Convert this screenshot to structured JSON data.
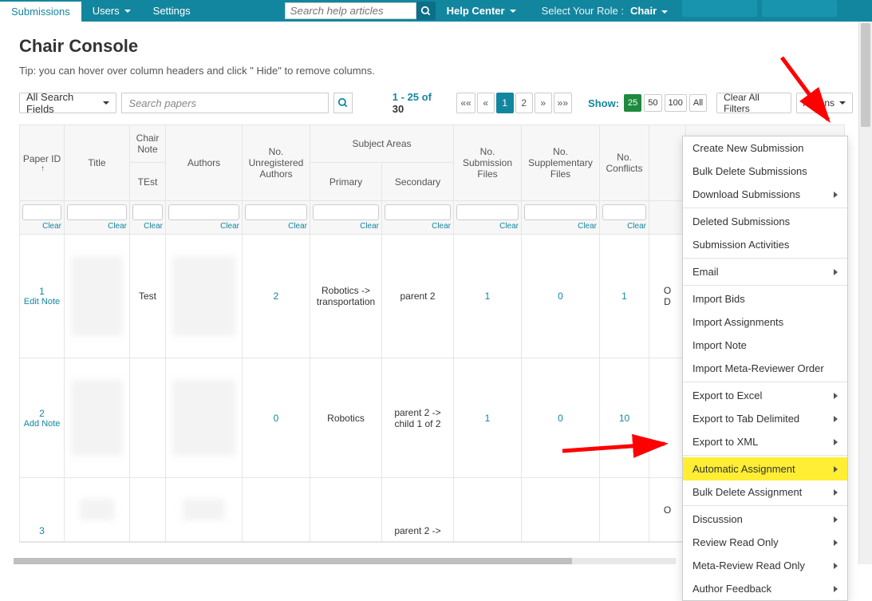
{
  "topnav": {
    "tabs": [
      "Submissions",
      "Users",
      "Settings"
    ],
    "search_placeholder": "Search help articles",
    "help_center": "Help Center",
    "role_label": "Select Your Role :",
    "role_value": "Chair"
  },
  "page": {
    "title": "Chair Console",
    "tip": "Tip: you can hover over column headers and click \" Hide\" to remove columns."
  },
  "toolbar": {
    "field_select": "All Search Fields",
    "paper_placeholder": "Search papers",
    "range": {
      "from": "1",
      "to": "25",
      "total": "30"
    },
    "pager_first": "««",
    "pager_prev": "«",
    "pager_pages": [
      "1",
      "2"
    ],
    "pager_next": "»",
    "pager_last": "»»",
    "show_label": "Show:",
    "show_options": [
      "25",
      "50",
      "100",
      "All"
    ],
    "clear_all": "Clear All Filters",
    "actions": "Actions"
  },
  "columns": {
    "paper_id": "Paper ID",
    "title": "Title",
    "chair_note": "Chair Note",
    "test": "TEst",
    "authors": "Authors",
    "unreg": "No. Unregistered Authors",
    "subject_areas": "Subject Areas",
    "primary": "Primary",
    "secondary": "Secondary",
    "nsf": "No. Submission Files",
    "nsup": "No. Supplementary Files",
    "conf": "No. Conflicts",
    "clear": "Clear"
  },
  "rows": [
    {
      "id": "1",
      "note_link": "Edit Note",
      "cnote": "Test",
      "unreg": "2",
      "primary": "Robotics -> transportation",
      "secondary": "parent 2",
      "nsf": "1",
      "nsup": "0",
      "conf": "1",
      "extra": "O\nD"
    },
    {
      "id": "2",
      "note_link": "Add Note",
      "cnote": "",
      "unreg": "0",
      "primary": "Robotics",
      "secondary": "parent 2 -> child 1 of 2",
      "nsf": "1",
      "nsup": "0",
      "conf": "10",
      "extra": ""
    },
    {
      "id": "3",
      "note_link": "",
      "cnote": "",
      "unreg": "",
      "primary": "",
      "secondary": "parent 2 ->",
      "nsf": "",
      "nsup": "",
      "conf": "",
      "extra": "O"
    }
  ],
  "actions_menu": {
    "groups": [
      [
        {
          "label": "Create New Submission"
        },
        {
          "label": "Bulk Delete Submissions"
        },
        {
          "label": "Download Submissions",
          "sub": true
        }
      ],
      [
        {
          "label": "Deleted Submissions"
        },
        {
          "label": "Submission Activities"
        }
      ],
      [
        {
          "label": "Email",
          "sub": true
        }
      ],
      [
        {
          "label": "Import Bids"
        },
        {
          "label": "Import Assignments"
        },
        {
          "label": "Import Note"
        },
        {
          "label": "Import Meta-Reviewer Order"
        }
      ],
      [
        {
          "label": "Export to Excel",
          "sub": true
        },
        {
          "label": "Export to Tab Delimited",
          "sub": true
        },
        {
          "label": "Export to XML",
          "sub": true
        }
      ],
      [
        {
          "label": "Automatic Assignment",
          "sub": true,
          "hl": true
        },
        {
          "label": "Bulk Delete Assignment",
          "sub": true
        }
      ],
      [
        {
          "label": "Discussion",
          "sub": true
        },
        {
          "label": "Review Read Only",
          "sub": true
        },
        {
          "label": "Meta-Review Read Only",
          "sub": true
        },
        {
          "label": "Author Feedback",
          "sub": true
        }
      ]
    ]
  }
}
